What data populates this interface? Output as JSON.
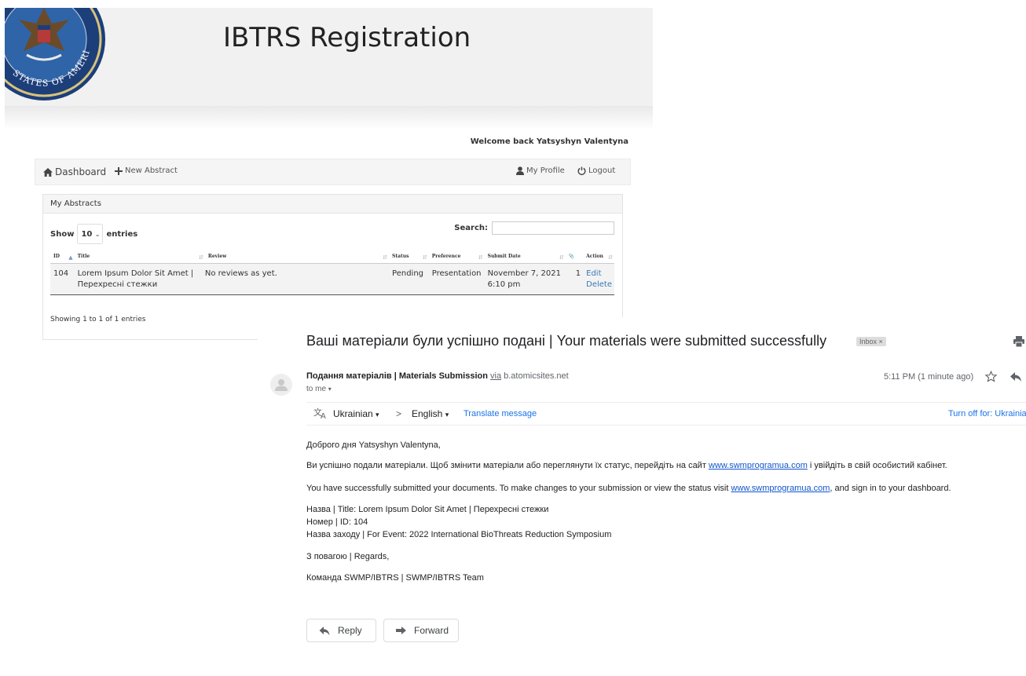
{
  "portal": {
    "title": "IBTRS Registration",
    "seal_text": "STATES OF AMERICA",
    "welcome": "Welcome back Yatsyshyn Valentyna",
    "nav": {
      "dashboard": "Dashboard",
      "new_abstract": "New Abstract",
      "my_profile": "My Profile",
      "logout": "Logout"
    },
    "panel": {
      "heading": "My Abstracts",
      "show_label": "Show",
      "entries_label": "entries",
      "length_value": "10",
      "search_label": "Search:",
      "columns": [
        "ID",
        "Title",
        "Review",
        "Status",
        "Preference",
        "Submit Date",
        "Action"
      ],
      "rows": [
        {
          "id": "104",
          "title": "Lorem Ipsum Dolor Sit Amet | Перехресні стежки",
          "review": "No reviews as yet.",
          "status": "Pending",
          "preference": "Presentation",
          "submit_date": "November 7, 2021 6:10 pm",
          "attachments": "1",
          "edit": "Edit",
          "delete": "Delete"
        }
      ],
      "showing": "Showing 1 to 1 of 1 entries"
    }
  },
  "email": {
    "subject": "Ваші матеріали були успішно подані | Your materials were submitted successfully",
    "label_badge": "Inbox ×",
    "sender_name": "Подання матеріалів | Materials Submission",
    "via_label": "via",
    "via_domain": "b.atomicsites.net",
    "recipient": "to me",
    "time": "5:11 PM (1 minute ago)",
    "translate": {
      "from_lang": "Ukrainian",
      "arrow": ">",
      "to_lang": "English",
      "translate_link": "Translate message",
      "turn_off": "Turn off for: Ukrainia"
    },
    "body": {
      "greeting": "Доброго дня Yatsyshyn Valentyna,",
      "ua_before": "Ви успішно подали матеріали. Щоб змінити матеріали або переглянути їх статус, перейдіть на сайт ",
      "ua_link": "www.swmprogramua.com",
      "ua_after": " і увійдіть в свій особистий кабінет.",
      "en_before": "You have successfully submitted your documents. To make changes to your submission or view the status visit ",
      "en_link": "www.swmprogramua.com",
      "en_after": ", and sign in to your dashboard.",
      "title_line": "Назва | Title: Lorem Ipsum Dolor Sit Amet | Перехресні стежки",
      "id_line": "Номер | ID: 104",
      "event_line": "Назва заходу | For Event: 2022 International BioThreats Reduction Symposium",
      "regards": "З повагою | Regards,",
      "team": "Команда SWMP/IBTRS | SWMP/IBTRS Team"
    },
    "buttons": {
      "reply": "Reply",
      "forward": "Forward"
    }
  }
}
